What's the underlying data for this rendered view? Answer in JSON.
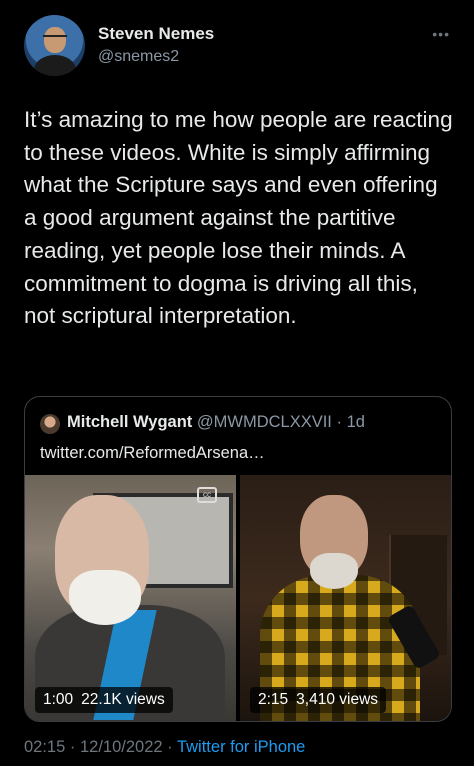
{
  "author": {
    "name": "Steven Nemes",
    "handle": "@snemes2",
    "more_icon": "more-dots-icon"
  },
  "tweet": {
    "text": "It’s amazing to me how people are reacting to these videos. White is simply affirming what the Scripture says and even offering a good argument against the partitive reading, yet people lose their minds. A commitment to dogma is driving all this, not scriptural interpretation."
  },
  "quote": {
    "name": "Mitchell Wygant",
    "handle": "@MWMDCLXXVII",
    "separator": "·",
    "age": "1d",
    "link": "twitter.com/ReformedArsena…",
    "videos": [
      {
        "duration": "1:00",
        "views": "22.1K views"
      },
      {
        "duration": "2:15",
        "views": "3,410 views"
      }
    ]
  },
  "footer": {
    "time": "02:15",
    "sep1": "·",
    "date": "12/10/2022",
    "sep2": "·",
    "app": "Twitter for iPhone"
  },
  "colors": {
    "background": "#000000",
    "text": "#e7e9ea",
    "secondary": "#8b98a5",
    "link": "#1d9bf0"
  }
}
